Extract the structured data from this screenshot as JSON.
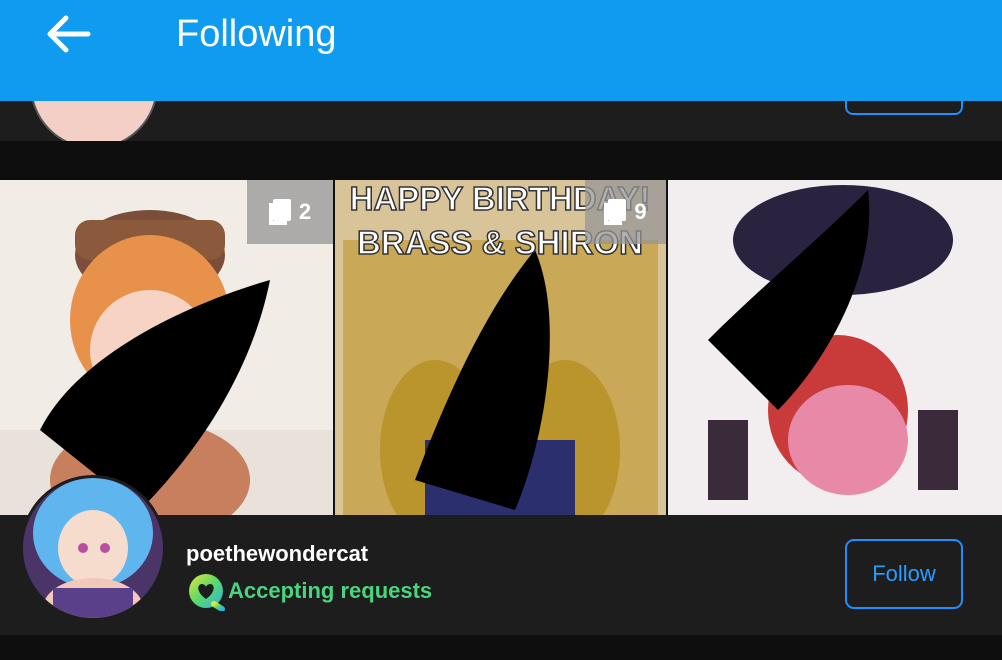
{
  "appbar": {
    "title": "Following",
    "back_icon": "arrow-left-icon",
    "color": "#0f9bf0"
  },
  "gallery": {
    "items": [
      {
        "count": "2",
        "icon": "pages-icon"
      },
      {
        "title_line1": "HAPPY BIRTHDAY!",
        "title_line2": "BRASS & SHIRON",
        "count": "9",
        "icon": "pages-icon"
      },
      {}
    ]
  },
  "user": {
    "username": "poethewondercat",
    "status": "Accepting requests",
    "status_color": "#4cd37e",
    "follow_label": "Follow",
    "accent": "#1e8fff"
  }
}
